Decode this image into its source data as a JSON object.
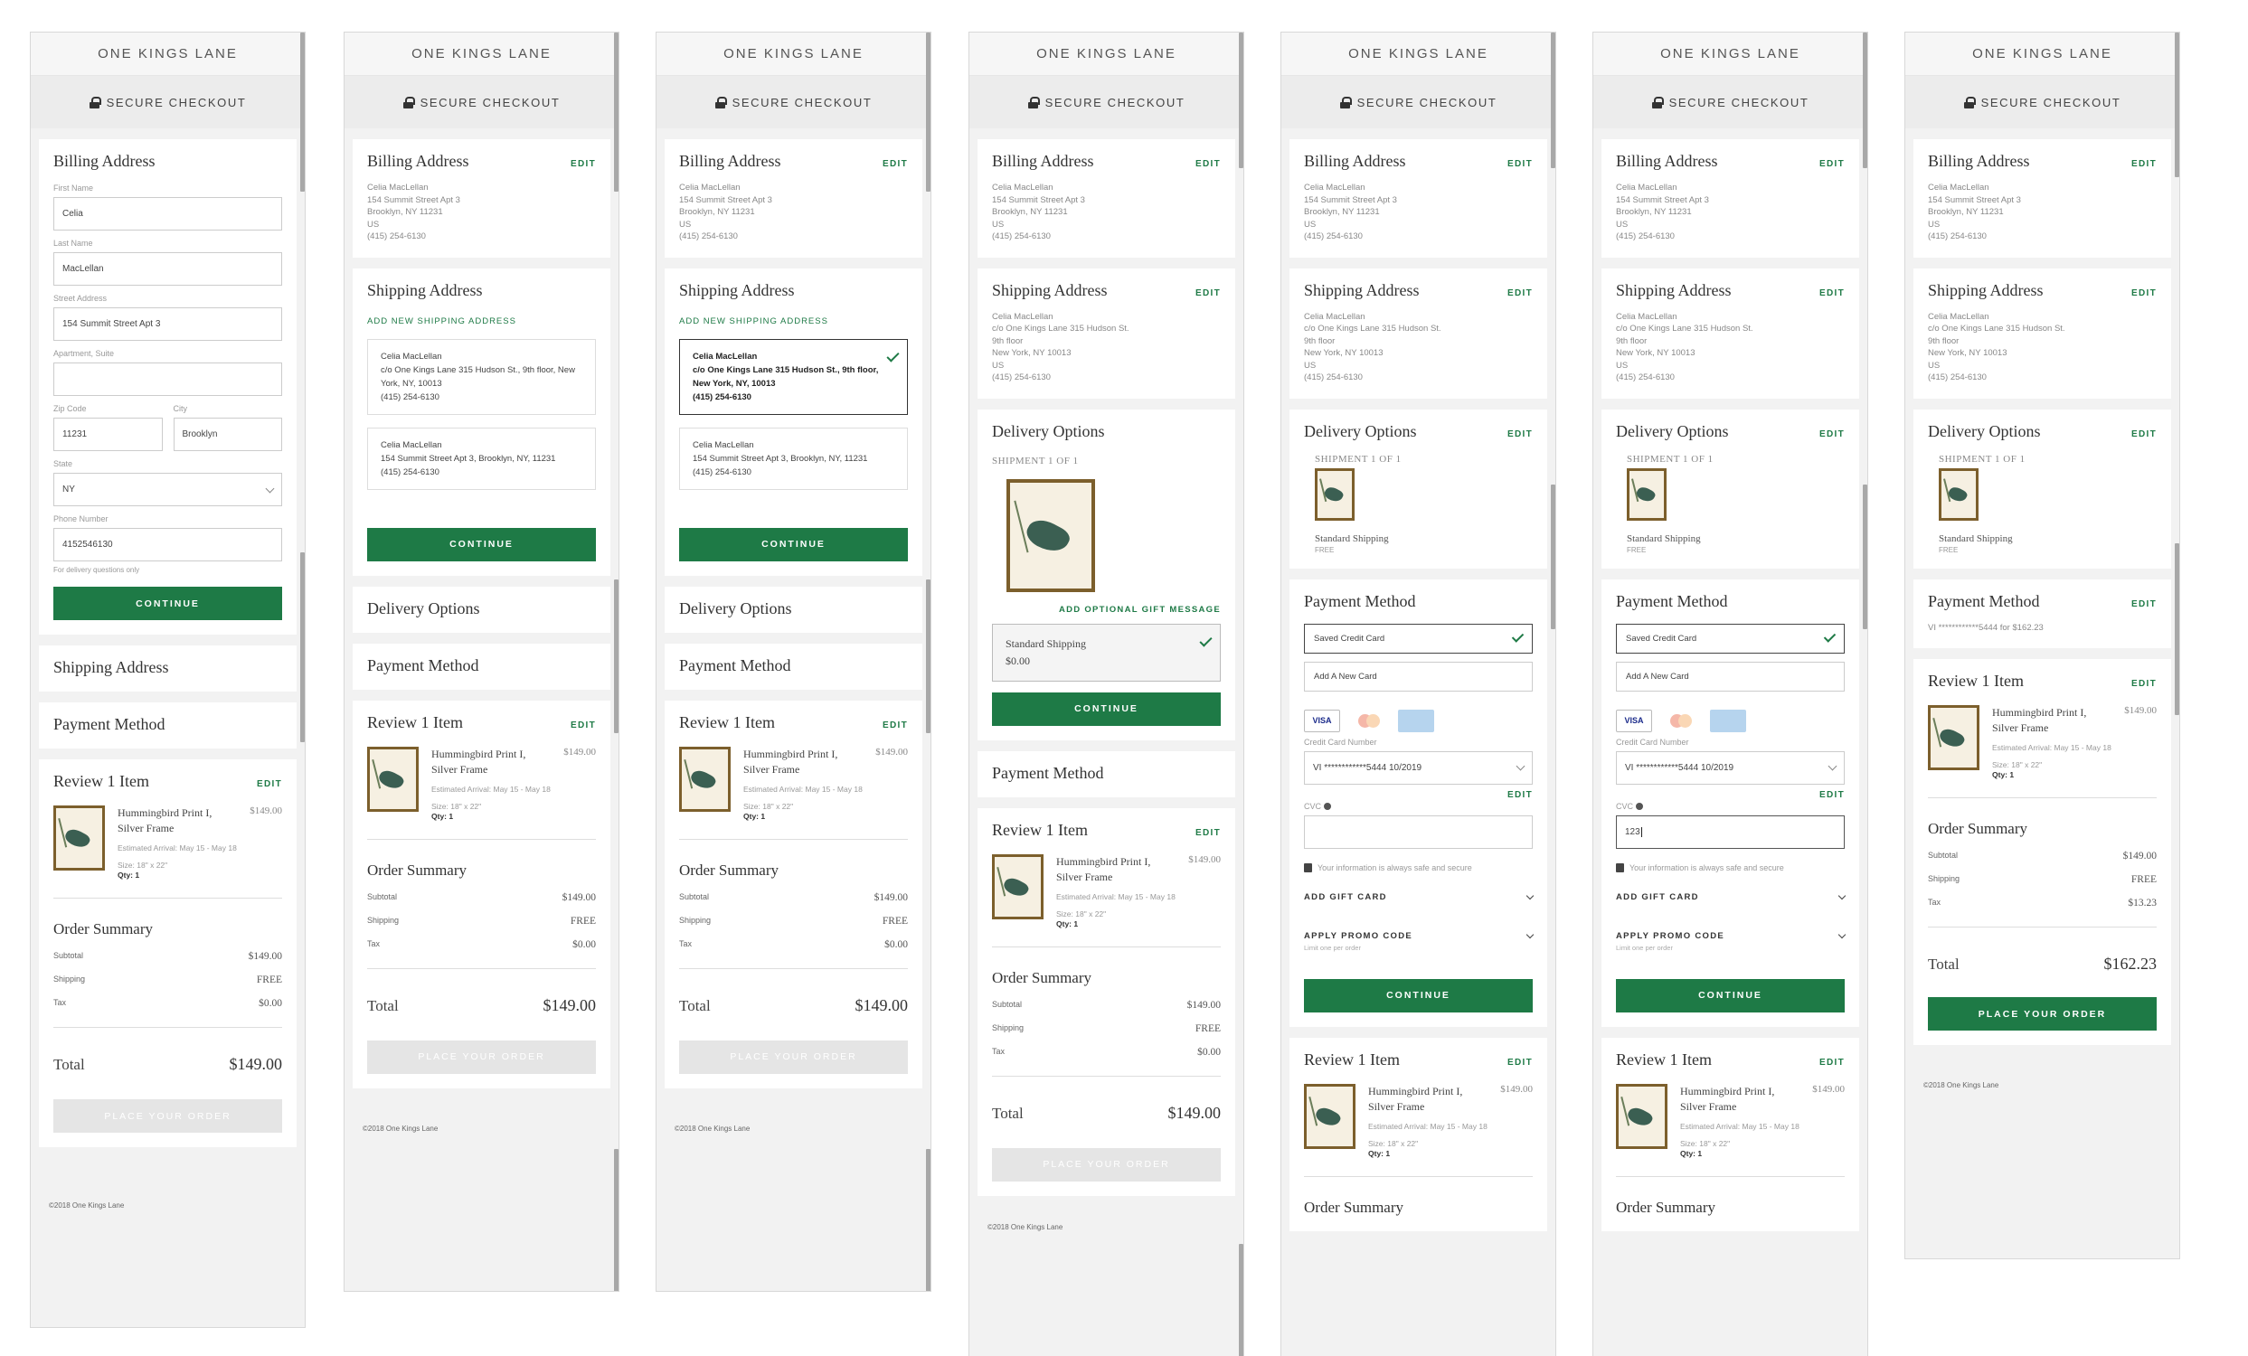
{
  "brand": "ONE KINGS LANE",
  "secure": "SECURE CHECKOUT",
  "continue": "CONTINUE",
  "place_order": "PLACE YOUR ORDER",
  "footer": "©2018 One Kings Lane",
  "edit": "EDIT",
  "billing": {
    "title": "Billing Address",
    "lines": [
      "Celia MacLellan",
      "154 Summit Street Apt 3",
      "Brooklyn, NY 11231",
      "US",
      "(415) 254-6130"
    ]
  },
  "billing_form": {
    "first_label": "First Name",
    "first_value": "Celia",
    "last_label": "Last Name",
    "last_value": "MacLellan",
    "street_label": "Street Address",
    "street_value": "154 Summit Street Apt 3",
    "apt_label": "Apartment, Suite",
    "apt_value": "",
    "zip_label": "Zip Code",
    "zip_value": "11231",
    "city_label": "City",
    "city_value": "Brooklyn",
    "state_label": "State",
    "state_value": "NY",
    "phone_label": "Phone Number",
    "phone_value": "4152546130",
    "phone_note": "For delivery questions only"
  },
  "shipping": {
    "title": "Shipping Address",
    "add_new": "ADD NEW SHIPPING ADDRESS",
    "option1": [
      "Celia MacLellan",
      "c/o One Kings Lane 315 Hudson St., 9th floor, New York, NY, 10013",
      "(415) 254-6130"
    ],
    "option2": [
      "Celia MacLellan",
      "154 Summit Street Apt 3, Brooklyn, NY, 11231",
      "(415) 254-6130"
    ],
    "summary": [
      "Celia MacLellan",
      "c/o One Kings Lane 315 Hudson St.",
      "9th floor",
      "New York, NY 10013",
      "US",
      "(415) 254-6130"
    ]
  },
  "delivery": {
    "title": "Delivery Options",
    "shipment": "SHIPMENT 1 OF 1",
    "gift": "ADD OPTIONAL GIFT MESSAGE",
    "method": "Standard Shipping",
    "price": "$0.00",
    "free": "FREE"
  },
  "payment": {
    "title": "Payment Method",
    "saved": "Saved Credit Card",
    "add_new": "Add A New Card",
    "visa": "VISA",
    "cc_label": "Credit Card Number",
    "cc_value": "VI ************5444 10/2019",
    "cvc_label": "CVC",
    "cvc_value": "123",
    "secure_note": "Your information is always safe and secure",
    "gift_card": "ADD GIFT CARD",
    "promo": "APPLY PROMO CODE",
    "promo_limit": "Limit one per order",
    "summary": "VI ************5444 for $162.23"
  },
  "review": {
    "title": "Review 1 Item",
    "name": "Hummingbird Print I, Silver Frame",
    "price": "$149.00",
    "arrival": "Estimated Arrival: May 15 - May 18",
    "size": "Size: 18\" x 22\"",
    "qty": "Qty: 1"
  },
  "summary": {
    "title": "Order Summary",
    "subtotal_label": "Subtotal",
    "subtotal": "$149.00",
    "shipping_label": "Shipping",
    "shipping": "FREE",
    "tax_label": "Tax",
    "tax": "$0.00",
    "tax_final": "$13.23",
    "total_label": "Total",
    "total": "$149.00",
    "total_final": "$162.23"
  }
}
